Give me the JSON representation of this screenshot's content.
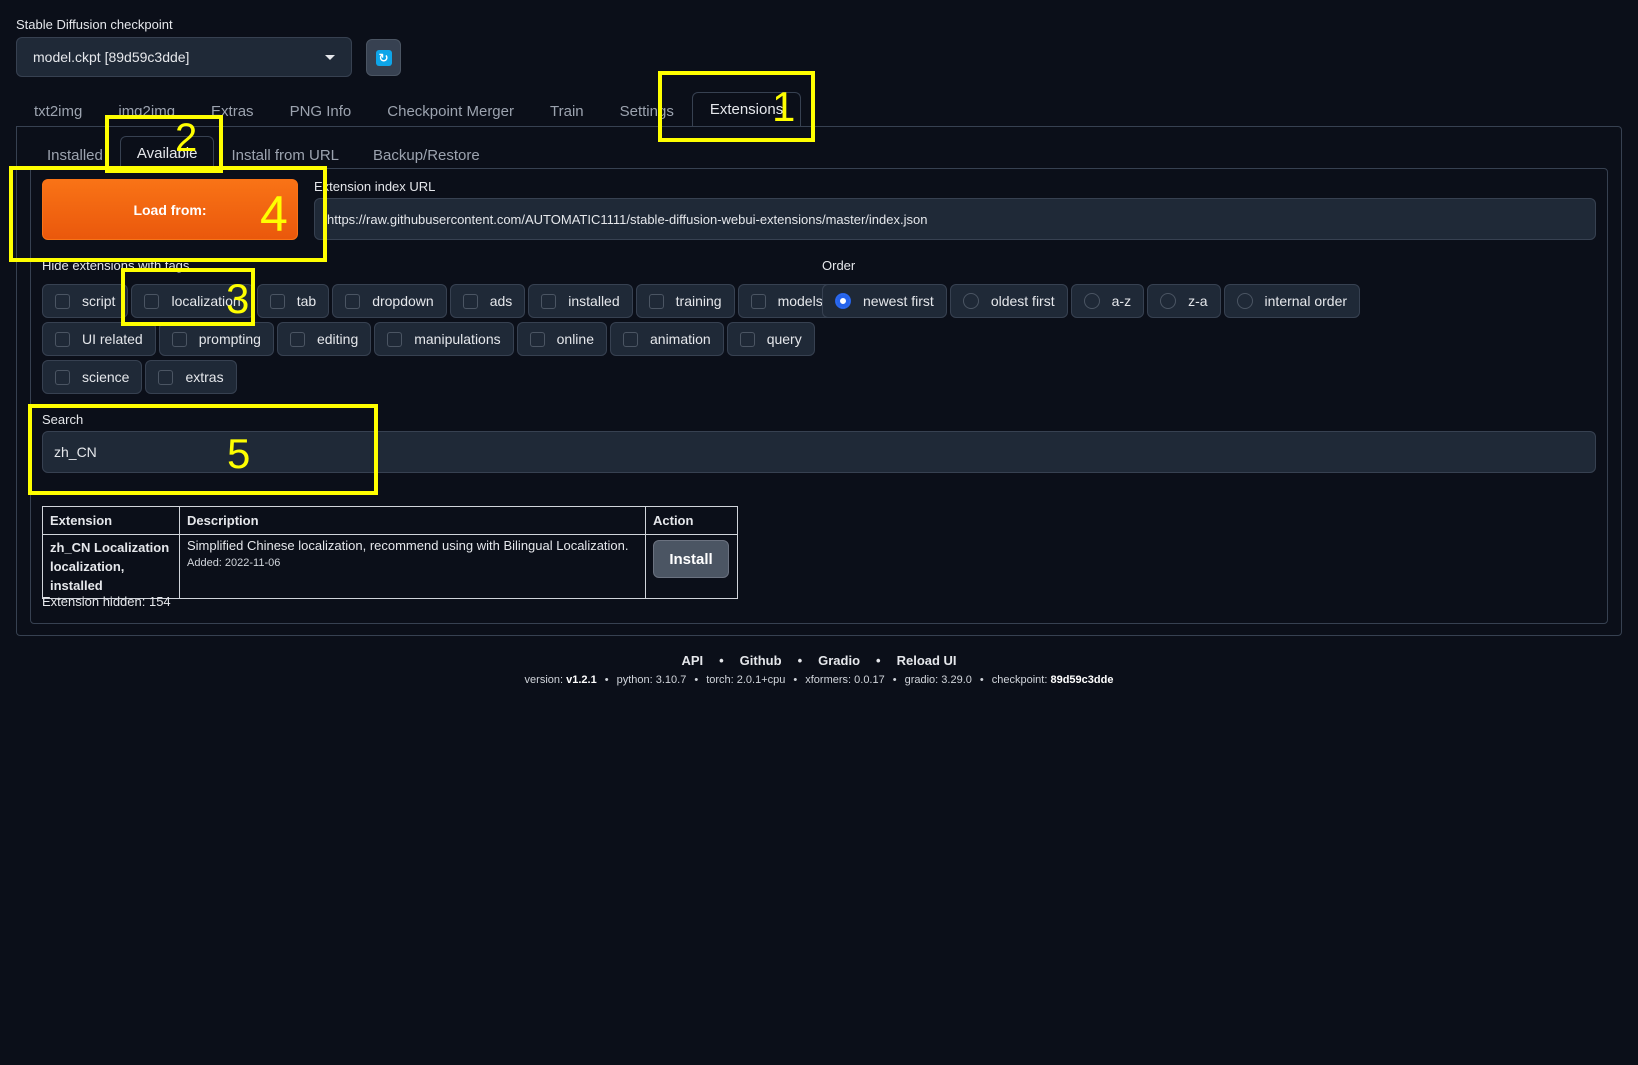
{
  "checkpoint": {
    "label": "Stable Diffusion checkpoint",
    "value": "model.ckpt [89d59c3dde]",
    "refresh_icon": "refresh-icon"
  },
  "top_tabs": [
    "txt2img",
    "img2img",
    "Extras",
    "PNG Info",
    "Checkpoint Merger",
    "Train",
    "Settings",
    "Extensions"
  ],
  "sub_tabs": [
    "Installed",
    "Available",
    "Install from URL",
    "Backup/Restore"
  ],
  "load_button": "Load from:",
  "index_url": {
    "label": "Extension index URL",
    "value": "https://raw.githubusercontent.com/AUTOMATIC1111/stable-diffusion-webui-extensions/master/index.json"
  },
  "hide_tags": {
    "label": "Hide extensions with tags",
    "rows": [
      [
        "script",
        "localization",
        "tab",
        "dropdown",
        "ads",
        "installed",
        "training",
        "models"
      ],
      [
        "UI related",
        "prompting",
        "editing",
        "manipulations",
        "online",
        "animation",
        "query"
      ],
      [
        "science",
        "extras"
      ]
    ]
  },
  "order": {
    "label": "Order",
    "options": [
      "newest first",
      "oldest first",
      "a-z",
      "z-a",
      "internal order"
    ],
    "selected": "newest first"
  },
  "search": {
    "label": "Search",
    "value": "zh_CN"
  },
  "table": {
    "headers": [
      "Extension",
      "Description",
      "Action"
    ],
    "rows": [
      {
        "name": "zh_CN Localization",
        "tags": "localization, installed",
        "description": "Simplified Chinese localization, recommend using with Bilingual Localization.",
        "added": "Added: 2022-11-06",
        "action": "Install"
      }
    ]
  },
  "hidden_count": "Extension hidden: 154",
  "footer": {
    "links": [
      "API",
      "Github",
      "Gradio",
      "Reload UI"
    ],
    "version_label": "version:",
    "version": "v1.2.1",
    "python": "python: 3.10.7",
    "torch": "torch: 2.0.1+cpu",
    "xformers": "xformers: 0.0.17",
    "gradio": "gradio: 3.29.0",
    "checkpoint_label": "checkpoint:",
    "checkpoint": "89d59c3dde"
  },
  "annotations": [
    "1",
    "2",
    "3",
    "4",
    "5"
  ],
  "colors": {
    "background": "#0b0f19",
    "accent_orange": "#f97316",
    "highlight_yellow": "#ffff00",
    "radio_selected": "#2563eb"
  }
}
